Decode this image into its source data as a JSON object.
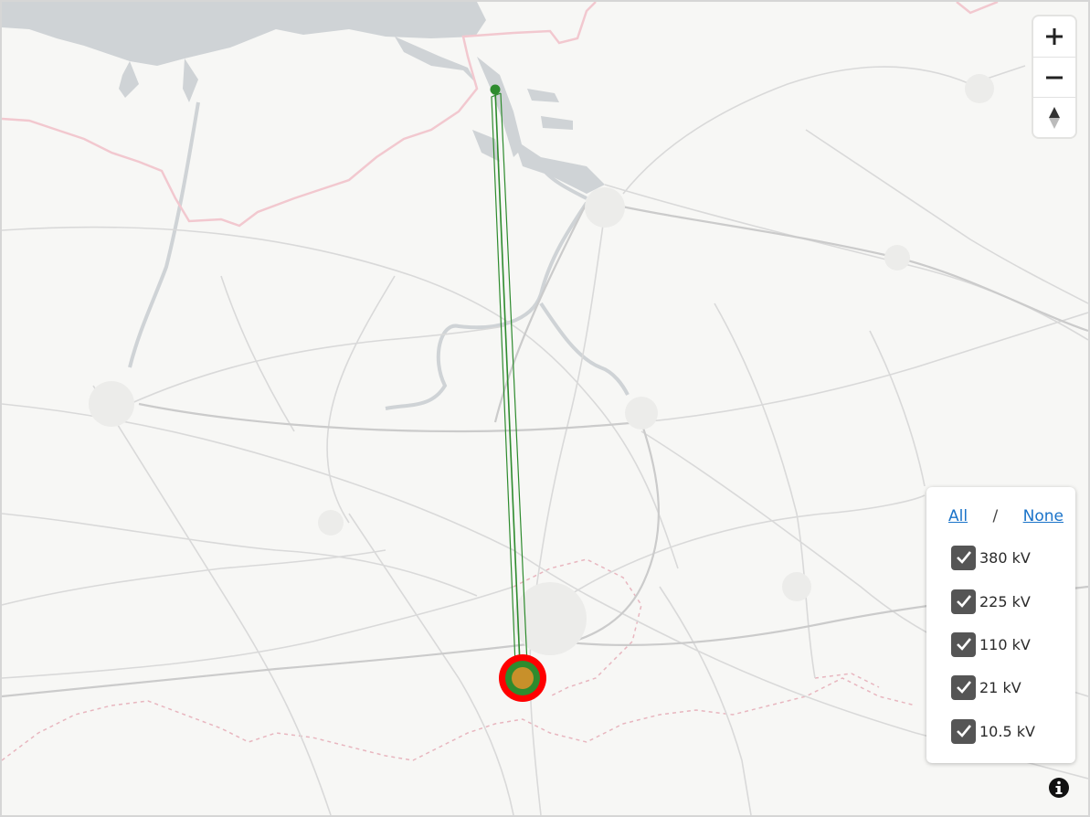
{
  "map": {
    "zoom_controls": {
      "zoom_in_icon": "plus-icon",
      "zoom_out_icon": "minus-icon",
      "compass_icon": "compass-north-icon"
    },
    "line": {
      "color": "#2e8b2e"
    },
    "substation_colors": {
      "outer": "#ff0000",
      "middle": "#2e8b2e",
      "inner": "#c8902a"
    }
  },
  "layer_panel": {
    "all_label": "All",
    "separator": "/",
    "none_label": "None",
    "layers": [
      {
        "label": "380 kV",
        "checked": true
      },
      {
        "label": "225 kV",
        "checked": true
      },
      {
        "label": "110 kV",
        "checked": true
      },
      {
        "label": "21 kV",
        "checked": true
      },
      {
        "label": "10.5 kV",
        "checked": true
      }
    ]
  },
  "info_icon": "info-icon"
}
